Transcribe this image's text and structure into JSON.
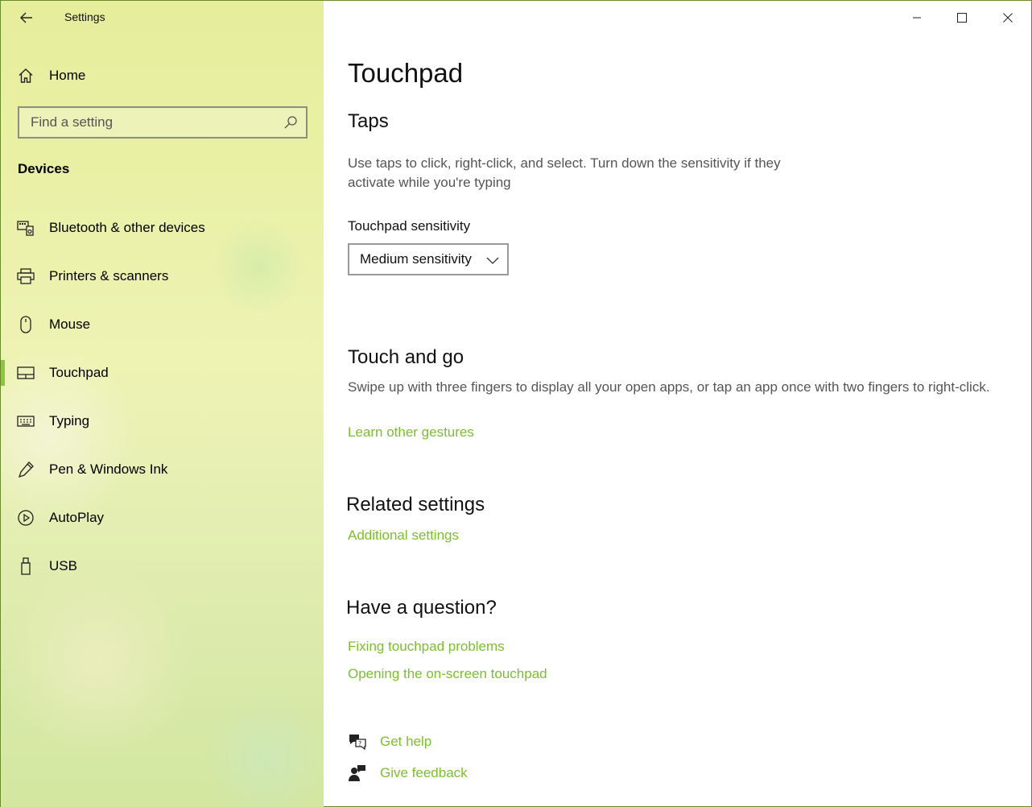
{
  "app": {
    "title": "Settings"
  },
  "sidebar": {
    "home_label": "Home",
    "search_placeholder": "Find a setting",
    "section_label": "Devices",
    "items": [
      {
        "label": "Bluetooth & other devices",
        "icon": "bluetooth-devices-icon"
      },
      {
        "label": "Printers & scanners",
        "icon": "printer-icon"
      },
      {
        "label": "Mouse",
        "icon": "mouse-icon"
      },
      {
        "label": "Touchpad",
        "icon": "touchpad-icon",
        "active": true
      },
      {
        "label": "Typing",
        "icon": "keyboard-icon"
      },
      {
        "label": "Pen & Windows Ink",
        "icon": "pen-icon"
      },
      {
        "label": "AutoPlay",
        "icon": "autoplay-icon"
      },
      {
        "label": "USB",
        "icon": "usb-icon"
      }
    ]
  },
  "main": {
    "title": "Touchpad",
    "taps": {
      "heading": "Taps",
      "description": "Use taps to click, right-click, and select. Turn down the sensitivity if they activate while you're typing",
      "sensitivity_label": "Touchpad sensitivity",
      "sensitivity_value": "Medium sensitivity"
    },
    "touch_and_go": {
      "heading": "Touch and go",
      "description": "Swipe up with three fingers to display all your open apps, or tap an app once with two fingers to right-click.",
      "link": "Learn other gestures"
    },
    "related": {
      "heading": "Related settings",
      "link": "Additional settings"
    },
    "question": {
      "heading": "Have a question?",
      "links": [
        "Fixing touchpad problems",
        "Opening the on-screen touchpad"
      ]
    },
    "help": {
      "get_help": "Get help",
      "give_feedback": "Give feedback"
    }
  },
  "colors": {
    "accent": "#7bbf2e",
    "active_bar": "#8cc63f"
  }
}
